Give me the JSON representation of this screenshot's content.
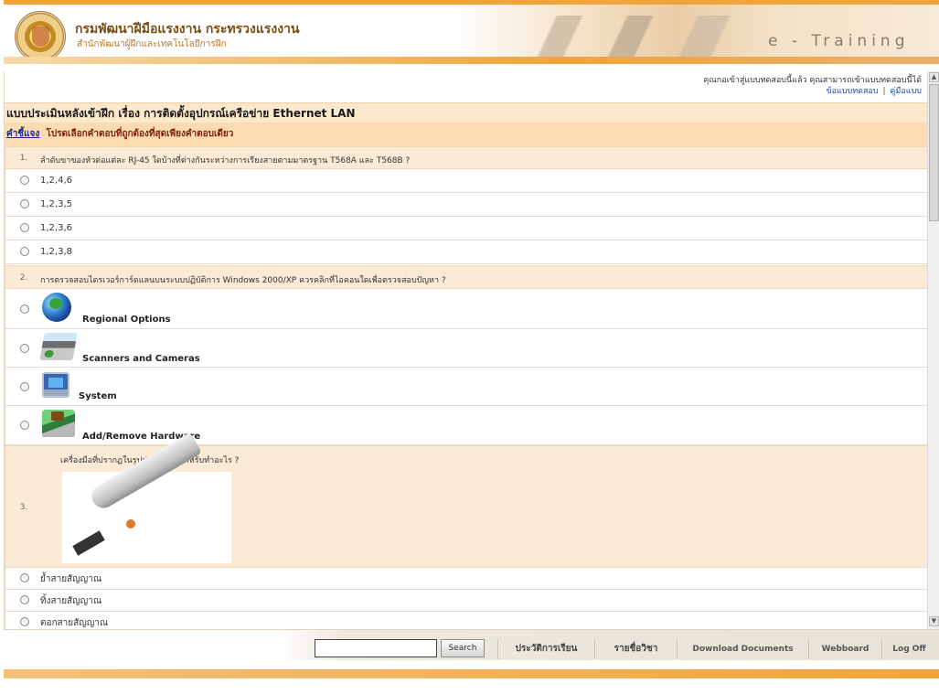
{
  "header": {
    "dept_name": "กรมพัฒนาฝีมือแรงงาน กระทรวงแรงงาน",
    "dept_sub": "สำนักพัฒนาผู้ฝึกและเทคโนโลยีการฝึก",
    "banner_text": "e - Training"
  },
  "info": {
    "line1": "คุณกอเข้าสู่แบบทดสอบนี้แล้ว คุณสามารถเข้าแบบทดสอบนี้ได้",
    "link_test": "ข้อแบบทดสอบ",
    "separator": "|",
    "link_manual": "คู่มือแบบ"
  },
  "quiz": {
    "title": "แบบประเมินหลังเข้าฝึก เรื่อง การติดตั้งอุปกรณ์เครือข่าย Ethernet LAN",
    "instruction_label": "คำชี้แจง",
    "instruction_text": "โปรดเลือกคำตอบที่ถูกต้องที่สุดเพียงคำตอบเดียว",
    "questions": [
      {
        "number": "1.",
        "text": "ลำดับขาของหัวต่อแต่ละ RJ-45 ใดบ้างที่ต่างกันระหว่างการเรียงสายตามมาตรฐาน T568A และ T568B ?",
        "options": [
          "1,2,4,6",
          "1,2,3,5",
          "1,2,3,6",
          "1,2,3,8"
        ]
      },
      {
        "number": "2.",
        "text": "การตรวจสอบไดรเวอร์การ์ดแลนบนระบบปฏิบัติการ Windows 2000/XP ควรคลิกที่ไอคอนใดเพื่อตรวจสอบปัญหา ?",
        "options": [
          "Regional Options",
          "Scanners and Cameras",
          "System",
          "Add/Remove Hardware"
        ],
        "option_icons": [
          "globe-icon",
          "scanner-icon",
          "system-icon",
          "hardware-icon"
        ]
      },
      {
        "number": "3.",
        "text": "เครื่องมือที่ปรากฏในรูปต่อไปนี้ ใช้สำหรับทำอะไร ?",
        "options": [
          "ย้ำสายสัญญาณ",
          "ทิ้งสายสัญญาณ",
          "ตอกสายสัญญาณ"
        ]
      }
    ]
  },
  "footer": {
    "search_placeholder": "",
    "search_button": "Search",
    "nav": [
      "ประวัติการเรียน",
      "รายชื่อวิชา",
      "Download Documents",
      "Webboard",
      "Log Off"
    ]
  },
  "colors": {
    "accent_orange": "#f0a43a",
    "title_bg": "#fce8cc",
    "question_bg": "#fbead5",
    "link_blue": "#1f4ea0"
  }
}
